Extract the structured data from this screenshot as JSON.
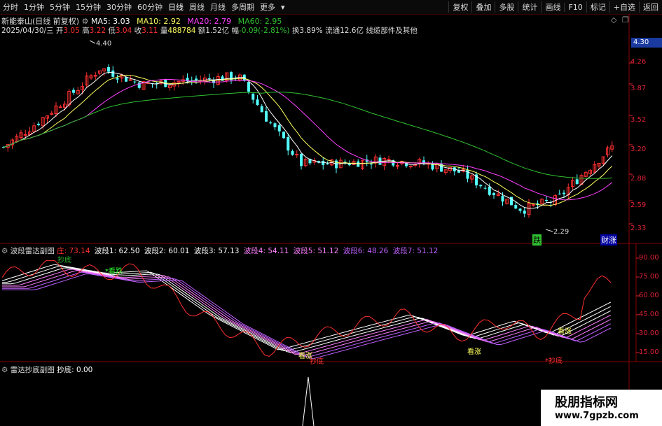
{
  "toolbar": {
    "left": [
      "分时",
      "1分钟",
      "5分钟",
      "15分钟",
      "30分钟",
      "60分钟",
      "日线",
      "周线",
      "月线",
      "多周期",
      "更多"
    ],
    "right": [
      "复权",
      "叠加",
      "多股",
      "统计",
      "画线",
      "F10",
      "标记",
      "+自选",
      "返回"
    ]
  },
  "header": {
    "name": "新能泰山(日线 前复权)",
    "ma5": "MA5: 3.03",
    "ma10": "MA10: 2.92",
    "ma20": "MA20: 2.79",
    "ma60": "MA60: 2.95"
  },
  "ohlc": {
    "date": "2025/04/30/三",
    "open_l": "开",
    "open": "3.05",
    "high_l": "高",
    "high": "3.22",
    "low_l": "低",
    "low": "3.04",
    "close_l": "收",
    "close": "3.11",
    "vol_l": "量",
    "vol": "488784",
    "amt_l": "额",
    "amt": "1.52亿",
    "chg_l": "幅",
    "chg": "-0.09(-2.81%)",
    "turn_l": "换",
    "turn": "3.89%",
    "float_l": "流通",
    "float": "12.6亿",
    "concept": "线缆部件及其他"
  },
  "price_axis": [
    "4.26",
    "3.87",
    "3.52",
    "3.20",
    "2.88",
    "2.59",
    "2.33"
  ],
  "price_tag": "4.30",
  "annotations": {
    "high": "4.40",
    "low": "2.29",
    "die": "跌",
    "cai": "财涨"
  },
  "panel2": {
    "name": "波段雷达副图",
    "zhuang": "庄: 73.14",
    "b1": "波段1: 62.50",
    "b2": "波段2: 60.01",
    "b3": "波段3: 57.13",
    "b4": "波段4: 54.11",
    "b5": "波段5: 51.12",
    "b6": "波段6: 48.26",
    "b7": "波段7: 51.12",
    "axis": [
      "90.00",
      "75.00",
      "60.00",
      "45.00",
      "30.00",
      "15.00"
    ],
    "labels": {
      "kankan_top": "看跌",
      "kanzhang": "看涨",
      "chaodi": "抄底",
      "chaodi2": "*抄底",
      "kanzhang2": "看涨",
      "kanzhang3": "看涨",
      "chaodi_top": "抄底"
    }
  },
  "panel3": {
    "name": "雷达抄底副图",
    "chaodi": "抄底: 0.00"
  },
  "watermark": {
    "line1": "股朋指标网",
    "line2": "www.7gpzb.com"
  },
  "colors": {
    "up": "#ff3030",
    "down": "#54ffff",
    "ma5": "#ffffff",
    "ma10": "#ffff60",
    "ma20": "#ff40ff",
    "ma60": "#30c030"
  }
}
